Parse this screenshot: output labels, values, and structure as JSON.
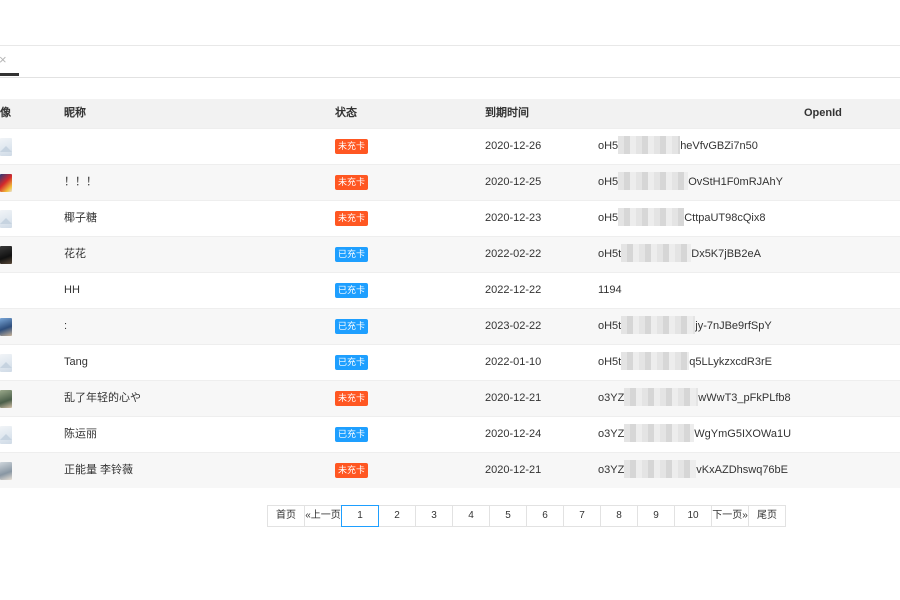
{
  "tab": {
    "close_glyph": "×"
  },
  "table": {
    "headers": {
      "avatar": "像",
      "nickname": "昵称",
      "status": "状态",
      "expiry": "到期时间",
      "openid": "OpenId"
    },
    "rows": [
      {
        "avatar": "default-avatar",
        "nickname": "",
        "status": "未充卡",
        "status_type": "unpaid",
        "expiry": "2020-12-26",
        "openid_prefix": "oH5",
        "openid_suffix": "heVfvGBZi7n50"
      },
      {
        "avatar": "photo-red",
        "nickname": "！！！",
        "status": "未充卡",
        "status_type": "unpaid",
        "expiry": "2020-12-25",
        "openid_prefix": "oH5",
        "openid_suffix": "OvStH1F0mRJAhY"
      },
      {
        "avatar": "default-avatar",
        "nickname": "椰子糖",
        "status": "未充卡",
        "status_type": "unpaid",
        "expiry": "2020-12-23",
        "openid_prefix": "oH5",
        "openid_suffix": "CttpaUT98cQix8"
      },
      {
        "avatar": "photo-dark",
        "nickname": "花花",
        "status": "已充卡",
        "status_type": "paid",
        "expiry": "2022-02-22",
        "openid_prefix": "oH5t",
        "openid_suffix": "Dx5K7jBB2eA"
      },
      {
        "avatar": "none",
        "nickname": "HH",
        "status": "已充卡",
        "status_type": "paid",
        "expiry": "2022-12-22",
        "openid_prefix": "1194",
        "openid_suffix": ""
      },
      {
        "avatar": "photo-blue",
        "nickname": ":",
        "status": "已充卡",
        "status_type": "paid",
        "expiry": "2023-02-22",
        "openid_prefix": "oH5t",
        "openid_suffix": "jy-7nJBe9rfSpY"
      },
      {
        "avatar": "default-avatar",
        "nickname": "Tang",
        "status": "已充卡",
        "status_type": "paid",
        "expiry": "2022-01-10",
        "openid_prefix": "oH5t",
        "openid_suffix": "q5LLykzxcdR3rE"
      },
      {
        "avatar": "photo-green",
        "nickname": "乱了年轻的心や",
        "status": "未充卡",
        "status_type": "unpaid",
        "expiry": "2020-12-21",
        "openid_prefix": "o3YZ",
        "openid_suffix": "wWwT3_pFkPLfb8"
      },
      {
        "avatar": "default-avatar",
        "nickname": "陈运丽",
        "status": "已充卡",
        "status_type": "paid",
        "expiry": "2020-12-24",
        "openid_prefix": "o3YZ",
        "openid_suffix": "WgYmG5IXOWa1U"
      },
      {
        "avatar": "photo-gray",
        "nickname": "正能量 李铃薇",
        "status": "未充卡",
        "status_type": "unpaid",
        "expiry": "2020-12-21",
        "openid_prefix": "o3YZ",
        "openid_suffix": "vKxAZDhswq76bE"
      }
    ]
  },
  "pagination": {
    "first": "首页",
    "prev": "«上一页",
    "pages": [
      "1",
      "2",
      "3",
      "4",
      "5",
      "6",
      "7",
      "8",
      "9",
      "10"
    ],
    "current": "1",
    "next": "下一页»",
    "last": "尾页"
  },
  "colors": {
    "unpaid": "#ff5722",
    "paid": "#1e9fff",
    "header_bg": "#f2f2f2",
    "alt_row": "#f7f7f7"
  }
}
